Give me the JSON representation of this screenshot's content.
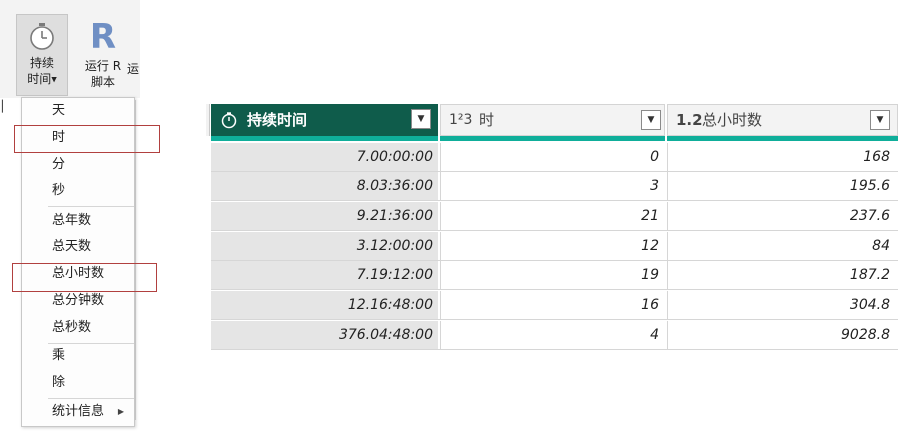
{
  "ribbon": {
    "duration_label_1": "持续",
    "duration_label_2": "时间",
    "run_r_label_1": "运行 R",
    "run_r_label_2": "脚本",
    "run_r_extra": "运"
  },
  "menu": {
    "items": [
      "天",
      "时",
      "分",
      "秒",
      "总年数",
      "总天数",
      "总小时数",
      "总分钟数",
      "总秒数",
      "乘",
      "除",
      "统计信息"
    ]
  },
  "table": {
    "columns": [
      {
        "type_icon": "duration-icon",
        "label": "持续时间"
      },
      {
        "type_icon": "1²3",
        "label": "时"
      },
      {
        "type_icon": "1.2",
        "label": "总小时数"
      }
    ],
    "rows": [
      [
        "7.00:00:00",
        "0",
        "168"
      ],
      [
        "8.03:36:00",
        "3",
        "195.6"
      ],
      [
        "9.21:36:00",
        "21",
        "237.6"
      ],
      [
        "3.12:00:00",
        "12",
        "84"
      ],
      [
        "7.19:12:00",
        "19",
        "187.2"
      ],
      [
        "12.16:48:00",
        "16",
        "304.8"
      ],
      [
        "376.04:48:00",
        "4",
        "9028.8"
      ]
    ]
  },
  "colors": {
    "header_active": "#0f5c4b",
    "quality_bar": "#0fae9a",
    "highlight_box": "#b1403f"
  }
}
